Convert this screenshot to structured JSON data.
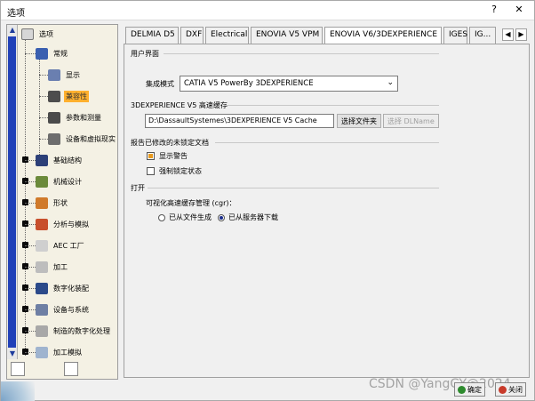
{
  "window": {
    "title": "选项",
    "help": "?",
    "close": "✕"
  },
  "tree": {
    "root": {
      "label": "选项",
      "icon": "options-root-icon"
    },
    "items": [
      {
        "label": "常规",
        "icon": "general-icon",
        "color": "#3a5fb0"
      },
      {
        "label": "显示",
        "icon": "display-icon",
        "color": "#6a7fb0"
      },
      {
        "label": "兼容性",
        "icon": "compatibility-icon",
        "color": "#4d4d4d",
        "selected": true
      },
      {
        "label": "参数和测量",
        "icon": "parameters-icon",
        "color": "#4b4b4b"
      },
      {
        "label": "设备和虚拟现实",
        "icon": "devices-vr-icon",
        "color": "#6d6d6d"
      },
      {
        "label": "基础结构",
        "icon": "infrastructure-icon",
        "color": "#2c3f78"
      },
      {
        "label": "机械设计",
        "icon": "mechanical-design-icon",
        "color": "#6b8a3a"
      },
      {
        "label": "形状",
        "icon": "shape-icon",
        "color": "#d07a2a"
      },
      {
        "label": "分析与模拟",
        "icon": "analysis-icon",
        "color": "#c84f2c"
      },
      {
        "label": "AEC 工厂",
        "icon": "aec-plant-icon",
        "color": "#cfcfcf"
      },
      {
        "label": "加工",
        "icon": "machining-icon",
        "color": "#bdbdbd"
      },
      {
        "label": "数字化装配",
        "icon": "digital-mockup-icon",
        "color": "#2b4a8a"
      },
      {
        "label": "设备与系统",
        "icon": "equipment-systems-icon",
        "color": "#6e7fa4"
      },
      {
        "label": "制造的数字化处理",
        "icon": "digital-process-icon",
        "color": "#a8a8a8"
      },
      {
        "label": "加工模拟",
        "icon": "machining-sim-icon",
        "color": "#9fb4cf"
      }
    ]
  },
  "tabs": [
    {
      "label": "DELMIA D5"
    },
    {
      "label": "DXF"
    },
    {
      "label": "Electrical"
    },
    {
      "label": "ENOVIA V5 VPM"
    },
    {
      "label": "ENOVIA V6/3DEXPERIENCE",
      "active": true
    },
    {
      "label": "IGES"
    },
    {
      "label": "IG..."
    }
  ],
  "tab_nav": {
    "prev": "◀",
    "next": "▶"
  },
  "panel": {
    "ui_section": "用户界面",
    "integration_label": "集成模式",
    "integration_value": "CATIA V5 PowerBy 3DEXPERIENCE",
    "cache_section": "3DEXPERIENCE V5 高速缓存",
    "cache_path": "D:\\DassaultSystemes\\3DEXPERIENCE V5 Cache",
    "choose_folder": "选择文件夹",
    "choose_dlname": "选择 DLName",
    "report_section": "报告已修改的未锁定文档",
    "show_warning": "显示警告",
    "show_warning_checked": true,
    "force_lock": "强制锁定状态",
    "force_lock_checked": false,
    "open_section": "打开",
    "cgr_label": "可视化高速缓存管理 (cgr)：",
    "from_file": "已从文件生成",
    "from_server": "已从服务器下载",
    "selected_radio": "from_server"
  },
  "footer": {
    "ok": "确定",
    "cancel": "关闭"
  },
  "watermark": "CSDN @YangGY@2024",
  "accent": "#ffb02e"
}
